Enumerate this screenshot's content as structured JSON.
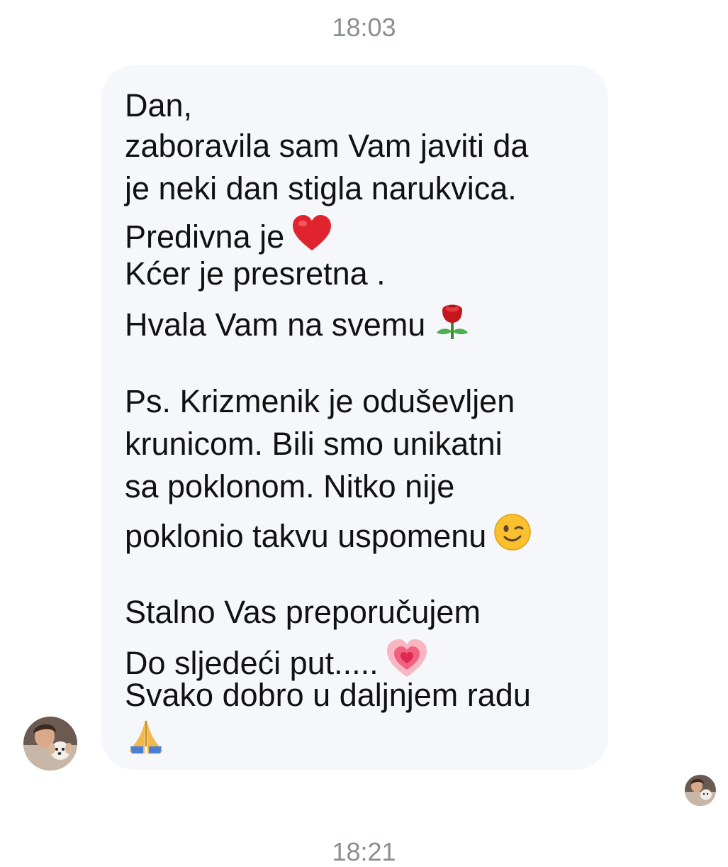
{
  "chat": {
    "timestamp_top": "18:03",
    "timestamp_bottom": "18:21",
    "message": {
      "lines": [
        "Dan,",
        "zaboravila sam Vam javiti da",
        "je neki dan stigla narukvica.",
        "Predivna je",
        "Kćer je presretna .",
        "Hvala Vam na svemu",
        "Ps. Krizmenik je oduševljen",
        "krunicom. Bili smo unikatni",
        "sa poklonom. Nitko nije",
        "poklonio takvu uspomenu",
        "Stalno Vas preporučujem",
        "Do sljedeći put.....",
        "Svako dobro u daljnjem radu"
      ],
      "emojis": {
        "line4": "red-heart",
        "line6": "rose",
        "line10": "winking-face",
        "line12": "growing-heart",
        "line14": "folded-hands"
      }
    },
    "colors": {
      "bubble": "#f5f7fa",
      "text": "#111111",
      "timestamp": "#8a8d91"
    }
  }
}
